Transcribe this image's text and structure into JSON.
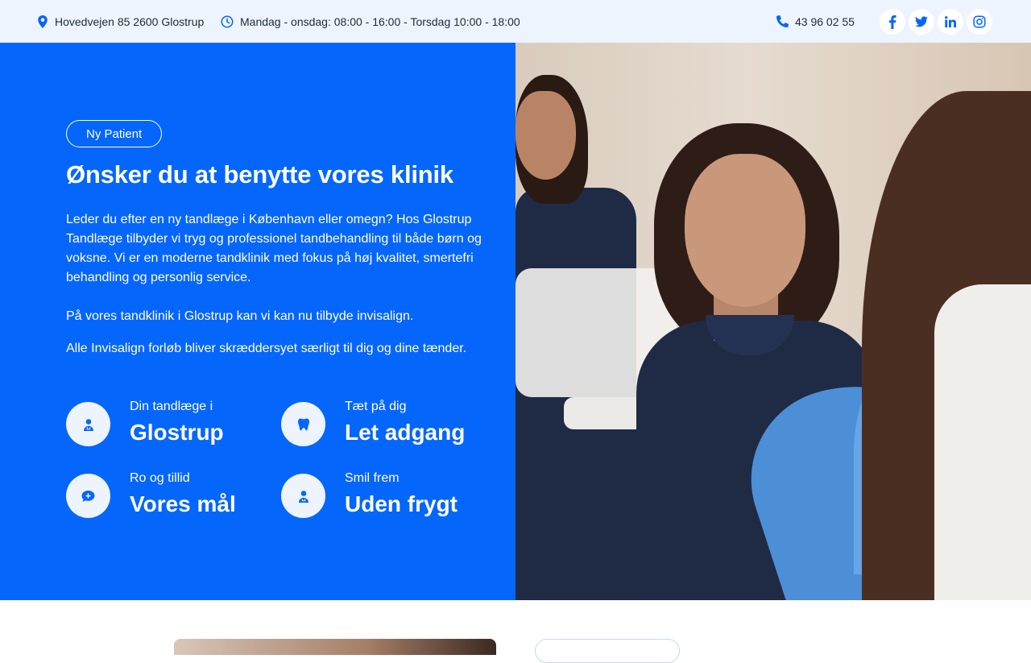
{
  "topbar": {
    "address": "Hovedvejen 85 2600 Glostrup",
    "hours": "Mandag - onsdag: 08:00 - 16:00 - Torsdag 10:00 - 18:00",
    "phone": "43 96 02 55",
    "socials": [
      "facebook-icon",
      "twitter-icon",
      "linkedin-icon",
      "instagram-icon"
    ]
  },
  "hero": {
    "pill_label": "Ny Patient",
    "title": "Ønsker du at benytte vores klinik",
    "paragraph1": "Leder du efter en ny tandlæge i København eller omegn? Hos Glostrup Tandlæge tilbyder vi tryg og professionel tandbehandling til både børn og voksne. Vi er en moderne tandklinik med fokus på høj kvalitet, smertefri behandling og personlig service.",
    "paragraph2": "På vores tandklinik i Glostrup kan vi kan nu tilbyde invisalign.",
    "paragraph3": "Alle Invisalign forløb bliver skræddersyet særligt til dig og dine tænder.",
    "features": [
      {
        "small": "Din tandlæge i",
        "big": "Glostrup",
        "icon": "dentist-icon"
      },
      {
        "small": "Tæt på dig",
        "big": "Let adgang",
        "icon": "tooth-icon"
      },
      {
        "small": "Ro og tillid",
        "big": "Vores mål",
        "icon": "chat-plus-icon"
      },
      {
        "small": "Smil frem",
        "big": "Uden frygt",
        "icon": "dentist-icon"
      }
    ]
  },
  "colors": {
    "brand_blue": "#0566fc",
    "topbar_bg": "#eef4fd"
  }
}
